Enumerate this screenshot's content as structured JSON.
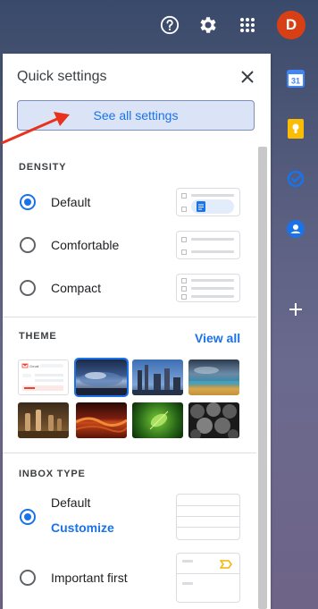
{
  "topbar": {
    "help_icon": "help-icon",
    "settings_icon": "gear-icon",
    "apps_icon": "apps-grid-icon",
    "avatar_letter": "D"
  },
  "side_panel": {
    "items": [
      "calendar-icon",
      "keep-icon",
      "tasks-icon",
      "contacts-icon",
      "add-icon"
    ],
    "calendar_day": "31"
  },
  "quick_settings": {
    "title": "Quick settings",
    "see_all_label": "See all settings",
    "density": {
      "heading": "DENSITY",
      "options": [
        {
          "label": "Default",
          "selected": true
        },
        {
          "label": "Comfortable",
          "selected": false
        },
        {
          "label": "Compact",
          "selected": false
        }
      ]
    },
    "theme": {
      "heading": "THEME",
      "view_all_label": "View all",
      "thumbnail_preview_text": "Gmail",
      "thumbnails": [
        "default-theme",
        "storm-clouds",
        "industrial-city",
        "beach-sunset",
        "chess-pieces",
        "lava",
        "green-leaf",
        "abstract-spheres"
      ],
      "selected_index": 1
    },
    "inbox_type": {
      "heading": "INBOX TYPE",
      "options": [
        {
          "label": "Default",
          "selected": true,
          "link": "Customize"
        },
        {
          "label": "Important first",
          "selected": false
        }
      ]
    }
  },
  "colors": {
    "accent": "#1a73e8",
    "avatar_bg": "#d93f15",
    "annotation_arrow": "#e8321e"
  }
}
